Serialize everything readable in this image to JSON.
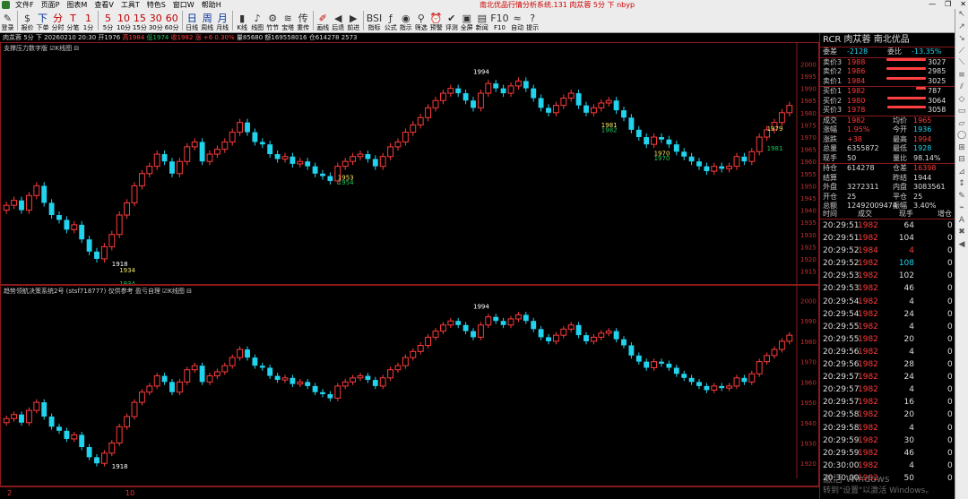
{
  "window": {
    "title": "南北优品行情分析系统.131 肉苁蓉 5分 下 nbyp",
    "menu": [
      "文件F",
      "页面P",
      "图表M",
      "查看V",
      "工具T",
      "特色S",
      "窗口W",
      "帮助H"
    ],
    "controls": [
      "—",
      "❐",
      "✕"
    ]
  },
  "toolbar": [
    {
      "glyph": "✎",
      "label": "登录",
      "color": "normal"
    },
    {
      "glyph": "$",
      "label": "报价",
      "color": "normal"
    },
    {
      "glyph": "下",
      "label": "下单",
      "color": "blue"
    },
    {
      "glyph": "分",
      "label": "分时",
      "color": "red"
    },
    {
      "glyph": "T",
      "label": "分笔",
      "color": "red"
    },
    {
      "glyph": "1",
      "label": "1分",
      "color": "red"
    },
    {
      "glyph": "5",
      "label": "5分",
      "color": "red"
    },
    {
      "glyph": "10",
      "label": "10分",
      "color": "red"
    },
    {
      "glyph": "15",
      "label": "15分",
      "color": "red"
    },
    {
      "glyph": "30",
      "label": "30分",
      "color": "red"
    },
    {
      "glyph": "60",
      "label": "60分",
      "color": "red"
    },
    {
      "glyph": "日",
      "label": "日线",
      "color": "blue"
    },
    {
      "glyph": "周",
      "label": "周线",
      "color": "blue"
    },
    {
      "glyph": "月",
      "label": "月线",
      "color": "blue"
    },
    {
      "glyph": "▮",
      "label": "K线",
      "color": "normal"
    },
    {
      "glyph": "♪",
      "label": "线图",
      "color": "normal"
    },
    {
      "glyph": "⚙",
      "label": "竹节",
      "color": "normal"
    },
    {
      "glyph": "≋",
      "label": "宝塔",
      "color": "normal"
    },
    {
      "glyph": "传",
      "label": "重传",
      "color": "normal"
    },
    {
      "glyph": "✐",
      "label": "画线",
      "color": "red"
    },
    {
      "glyph": "◀",
      "label": "后退",
      "color": "normal"
    },
    {
      "glyph": "▶",
      "label": "前进",
      "color": "normal"
    },
    {
      "glyph": "BSI",
      "label": "指标",
      "color": "normal"
    },
    {
      "glyph": "ƒ",
      "label": "公式",
      "color": "normal"
    },
    {
      "glyph": "◉",
      "label": "指示",
      "color": "normal"
    },
    {
      "glyph": "⚲",
      "label": "筛选",
      "color": "normal"
    },
    {
      "glyph": "⏰",
      "label": "预警",
      "color": "normal"
    },
    {
      "glyph": "✔",
      "label": "评测",
      "color": "normal"
    },
    {
      "glyph": "▣",
      "label": "全屏",
      "color": "normal"
    },
    {
      "glyph": "▤",
      "label": "新闻",
      "color": "normal"
    },
    {
      "glyph": "F10",
      "label": "F10",
      "color": "normal"
    },
    {
      "glyph": "≈",
      "label": "自动",
      "color": "normal"
    },
    {
      "glyph": "?",
      "label": "提示",
      "color": "normal"
    }
  ],
  "infoline": {
    "name": "肉苁蓉 5分 下",
    "datetime": "20260210 20:30",
    "open": "开1976",
    "high": "高1984",
    "low": "低1974",
    "close": "收1982",
    "change": "涨 +6 0.30%",
    "vol": "量85680",
    "amount": "额169558016",
    "oi": "仓614278 2573"
  },
  "panel1": {
    "title": "支撑压力数字版 ☑K线图 ⊟",
    "yticks": [
      "2000",
      "1995",
      "1990",
      "1985",
      "1980",
      "1975",
      "1970",
      "1965",
      "1960",
      "1955",
      "1950",
      "1945",
      "1940",
      "1935",
      "1930",
      "1925",
      "1920",
      "1915"
    ],
    "labels": [
      {
        "text": "1994",
        "color": "#ffffff"
      },
      {
        "text": "1918",
        "color": "#ffffff"
      },
      {
        "text": "1934",
        "color": "#f5e663"
      },
      {
        "text": "1934",
        "color": "#22c55e"
      },
      {
        "text": "1953",
        "color": "#f5e663"
      },
      {
        "text": "1954",
        "color": "#22c55e"
      },
      {
        "text": "1981",
        "color": "#f5e663"
      },
      {
        "text": "1982",
        "color": "#22c55e"
      },
      {
        "text": "1970",
        "color": "#f5e663"
      },
      {
        "text": "1970",
        "color": "#22c55e"
      },
      {
        "text": "1979",
        "color": "#f5e663"
      },
      {
        "text": "1981",
        "color": "#22c55e"
      }
    ]
  },
  "panel2": {
    "title": "趋势领航决策系统2号 (stsf718777) 仅供参考 盈亏自理 ☑K线图 ⊟",
    "yticks": [
      "2000",
      "1990",
      "1980",
      "1970",
      "1960",
      "1950",
      "1940",
      "1930",
      "1920"
    ],
    "peak_label": "1994",
    "trough_label": "1918"
  },
  "bottombar": {
    "a": "2",
    "b": "10"
  },
  "quote": {
    "header": "RCR  肉苁蓉   南北优品",
    "weibi": {
      "l": "委差",
      "v": "-2128",
      "l2": "委比",
      "v2": "-13.35%"
    },
    "asks": [
      {
        "l": "卖价3",
        "p": "1988",
        "q": "3027"
      },
      {
        "l": "卖价2",
        "p": "1986",
        "q": "2985"
      },
      {
        "l": "卖价1",
        "p": "1984",
        "q": "3025"
      }
    ],
    "bids": [
      {
        "l": "买价1",
        "p": "1982",
        "q": "787"
      },
      {
        "l": "买价2",
        "p": "1980",
        "q": "3064"
      },
      {
        "l": "买价3",
        "p": "1978",
        "q": "3058"
      }
    ],
    "stats": [
      {
        "l": "成交",
        "v": "1982",
        "c": "red",
        "l2": "均价",
        "v2": "1965",
        "c2": "red"
      },
      {
        "l": "涨幅",
        "v": "1.95%",
        "c": "red",
        "l2": "今开",
        "v2": "1936",
        "c2": "cyan"
      },
      {
        "l": "涨跌",
        "v": "+38",
        "c": "red",
        "l2": "最高",
        "v2": "1994",
        "c2": "red"
      },
      {
        "l": "总量",
        "v": "6355872",
        "c": "white",
        "l2": "最低",
        "v2": "1928",
        "c2": "cyan"
      },
      {
        "l": "现手",
        "v": "50",
        "c": "white",
        "l2": "量比",
        "v2": "98.14%",
        "c2": "white"
      }
    ],
    "stats2": [
      {
        "l": "持仓",
        "v": "614278",
        "c": "white",
        "l2": "仓差",
        "v2": "16398",
        "c2": "red"
      },
      {
        "l": "结算",
        "v": "",
        "c": "white",
        "l2": "昨结",
        "v2": "1944",
        "c2": "white"
      },
      {
        "l": "外盘",
        "v": "3272311",
        "c": "white",
        "l2": "内盘",
        "v2": "3083561",
        "c2": "white"
      },
      {
        "l": "开仓",
        "v": "25",
        "c": "white",
        "l2": "平仓",
        "v2": "25",
        "c2": "white"
      },
      {
        "l": "总额",
        "v": "12492009474",
        "c": "white",
        "l2": "振幅",
        "v2": "3.40%",
        "c2": "white"
      }
    ],
    "ticks_header": [
      "时间",
      "成交",
      "现手",
      "增仓"
    ],
    "ticks": [
      {
        "t": "20:29:51",
        "p": "1982",
        "q": "64",
        "z": "0",
        "qc": "white"
      },
      {
        "t": "20:29:51",
        "p": "1982",
        "q": "104",
        "z": "0",
        "qc": "white"
      },
      {
        "t": "20:29:52",
        "p": "1984",
        "q": "4",
        "z": "0",
        "qc": "red"
      },
      {
        "t": "20:29:52",
        "p": "1982",
        "q": "108",
        "z": "0",
        "qc": "cyan"
      },
      {
        "t": "20:29:53",
        "p": "1982",
        "q": "102",
        "z": "0",
        "qc": "white"
      },
      {
        "t": "20:29:53",
        "p": "1982",
        "q": "46",
        "z": "0",
        "qc": "white"
      },
      {
        "t": "20:29:54",
        "p": "1982",
        "q": "4",
        "z": "0",
        "qc": "white"
      },
      {
        "t": "20:29:54",
        "p": "1982",
        "q": "24",
        "z": "0",
        "qc": "white"
      },
      {
        "t": "20:29:55",
        "p": "1982",
        "q": "4",
        "z": "0",
        "qc": "white"
      },
      {
        "t": "20:29:55",
        "p": "1982",
        "q": "20",
        "z": "0",
        "qc": "white"
      },
      {
        "t": "20:29:56",
        "p": "1982",
        "q": "4",
        "z": "0",
        "qc": "white"
      },
      {
        "t": "20:29:56",
        "p": "1982",
        "q": "28",
        "z": "0",
        "qc": "white"
      },
      {
        "t": "20:29:57",
        "p": "1982",
        "q": "24",
        "z": "0",
        "qc": "white"
      },
      {
        "t": "20:29:57",
        "p": "1982",
        "q": "4",
        "z": "0",
        "qc": "white"
      },
      {
        "t": "20:29:57",
        "p": "1982",
        "q": "16",
        "z": "0",
        "qc": "white"
      },
      {
        "t": "20:29:58",
        "p": "1982",
        "q": "20",
        "z": "0",
        "qc": "white"
      },
      {
        "t": "20:29:58",
        "p": "1982",
        "q": "4",
        "z": "0",
        "qc": "white"
      },
      {
        "t": "20:29:59",
        "p": "1982",
        "q": "30",
        "z": "0",
        "qc": "white"
      },
      {
        "t": "20:29:59",
        "p": "1982",
        "q": "46",
        "z": "0",
        "qc": "white"
      },
      {
        "t": "20:30:00",
        "p": "1982",
        "q": "4",
        "z": "0",
        "qc": "white"
      },
      {
        "t": "20:30:00",
        "p": "1982",
        "q": "50",
        "z": "0",
        "qc": "white"
      }
    ],
    "watermark": "激活 Windows",
    "watermark2": "转到\"设置\"以激活 Windows。"
  },
  "colors": {
    "up": "#ff3b3b",
    "down": "#22d3ee",
    "frame": "#8a1a1a",
    "bg": "#000000"
  },
  "rtools": [
    "↖",
    "↗",
    "↘",
    "⟋",
    "⟍",
    "≡",
    "⫽",
    "◇",
    "▭",
    "▱",
    "◯",
    "⊞",
    "⊟",
    "⊿",
    "↕",
    "✎",
    "⌁",
    "A",
    "✖",
    "◀"
  ]
}
